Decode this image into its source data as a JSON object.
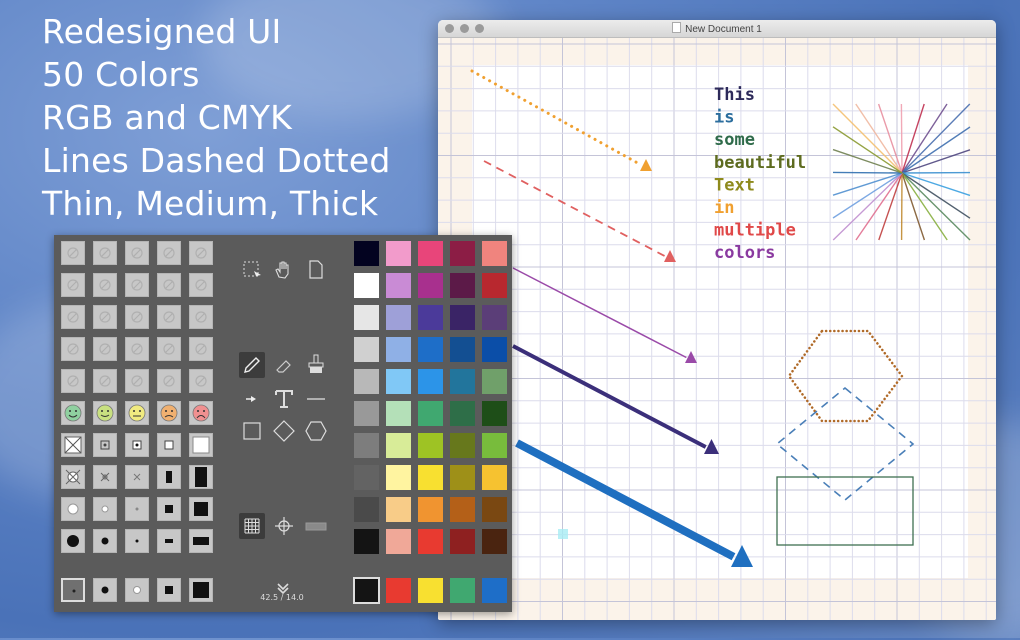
{
  "promo": {
    "lines": [
      "Redesigned UI",
      "50 Colors",
      "RGB and CMYK",
      "Lines Dashed Dotted",
      "Thin, Medium, Thick"
    ]
  },
  "window": {
    "title": "New Document 1",
    "traffic_lights": [
      "close",
      "minimize",
      "zoom"
    ]
  },
  "canvas": {
    "text_lines": [
      {
        "text": "This",
        "color": "#2d2a5a"
      },
      {
        "text": "is",
        "color": "#2c6e9e"
      },
      {
        "text": "some",
        "color": "#2f6b4a"
      },
      {
        "text": "beautiful",
        "color": "#5d6b1f"
      },
      {
        "text": "Text",
        "color": "#8e8a1c"
      },
      {
        "text": "in",
        "color": "#f0a030"
      },
      {
        "text": "multiple",
        "color": "#e04848"
      },
      {
        "text": "colors",
        "color": "#8a3aa0"
      }
    ],
    "arrows": [
      {
        "style": "dotted",
        "weight": "medium",
        "color": "#f0a030"
      },
      {
        "style": "dashed",
        "weight": "medium",
        "color": "#e06060"
      },
      {
        "style": "solid",
        "weight": "thin",
        "color": "#9a4aa8"
      },
      {
        "style": "solid",
        "weight": "medium",
        "color": "#3b2f7a"
      },
      {
        "style": "solid",
        "weight": "thick",
        "color": "#1f6fc0"
      }
    ],
    "shapes": [
      {
        "type": "hexagon",
        "style": "dotted",
        "color": "#b06a28"
      },
      {
        "type": "diamond",
        "style": "dashed",
        "color": "#4a7fb8"
      },
      {
        "type": "rectangle",
        "style": "solid",
        "color": "#3f7050"
      }
    ],
    "starburst_colors": [
      "#f4c070",
      "#f0b8a0",
      "#e890a0",
      "#f0a0b0",
      "#c03050",
      "#705090",
      "#4a6fb0",
      "#3f6fb0",
      "#504880",
      "#3a90d0",
      "#3aa0e0",
      "#405060",
      "#5a8a60",
      "#88b040",
      "#805a30",
      "#c08a30",
      "#c04040",
      "#e07090",
      "#c090d0",
      "#70a0e0",
      "#5090d0",
      "#3070b0",
      "#708050",
      "#8a9a30"
    ],
    "cursor_marker_color": "#a8ecf4"
  },
  "palette": {
    "left_grid": {
      "blank_rows": 5,
      "smileys": [
        "#8fd0a0",
        "#c8e080",
        "#f0ea80",
        "#f0b070",
        "#f09090"
      ],
      "symbol_rows": [
        [
          "snap-all-icon",
          "snap-center-icon",
          "snap-dot-icon",
          "small-square-icon",
          "large-square-icon"
        ],
        [
          "move-all-icon",
          "move-x-icon",
          "cross-icon",
          "tall-rect-icon",
          "tall-rect-large-icon"
        ],
        [
          "circle-outline-large-icon",
          "circle-outline-medium-icon",
          "dot-small-icon",
          "square-filled-small-icon",
          "square-filled-large-icon"
        ],
        [
          "dot-large-icon",
          "dot-medium-icon",
          "dot-tiny-icon",
          "dash-small-icon",
          "dash-large-icon"
        ]
      ],
      "bottom_row": [
        "point-size-1",
        "point-size-2",
        "point-size-3",
        "point-size-4",
        "point-size-5"
      ]
    },
    "tools": {
      "top": [
        "select-tool",
        "hand-tool",
        "new-page-tool"
      ],
      "draw": [
        "pencil-tool",
        "eraser-tool",
        "brush-tool"
      ],
      "misc": [
        "arrow-tool",
        "text-tool",
        "line-tool"
      ],
      "shapes": [
        "rectangle-tool",
        "diamond-tool",
        "hexagon-tool"
      ],
      "bottom": [
        "grid-toggle",
        "crosshair-toggle",
        "ruler-toggle"
      ],
      "expand_label": "expand",
      "coords": "42.5 / 14.0"
    },
    "colors": [
      [
        "#030320",
        "#f29bcb",
        "#e8457a",
        "#8c1d45",
        "#f0847e"
      ],
      [
        "#ffffff",
        "#c98bd5",
        "#a8308e",
        "#5c1a48",
        "#b8282f"
      ],
      [
        "#e6e6e6",
        "#9ea0d8",
        "#4b3a9a",
        "#3a2466",
        "#5b3e78"
      ],
      [
        "#d0d0d0",
        "#8fb0e6",
        "#1e6ec8",
        "#134f92",
        "#0b4ea8"
      ],
      [
        "#b8b8b8",
        "#80c8f6",
        "#2c94e8",
        "#22759c",
        "#70a06a"
      ],
      [
        "#999999",
        "#b4e0b8",
        "#40a870",
        "#2e6e48",
        "#1e4e18"
      ],
      [
        "#7d7d7d",
        "#d8ec98",
        "#9ec324",
        "#67781c",
        "#78bc3c"
      ],
      [
        "#636363",
        "#fff4a0",
        "#f8e030",
        "#9e9018",
        "#f6c230"
      ],
      [
        "#4a4a4a",
        "#f8cc88",
        "#f09430",
        "#b46018",
        "#7a4812"
      ],
      [
        "#141414",
        "#f0a898",
        "#e83a30",
        "#8e2020",
        "#4a2410"
      ]
    ],
    "recent_colors": [
      "#141414",
      "#e83a30",
      "#f8e030",
      "#40a870",
      "#1e6ec8"
    ]
  }
}
